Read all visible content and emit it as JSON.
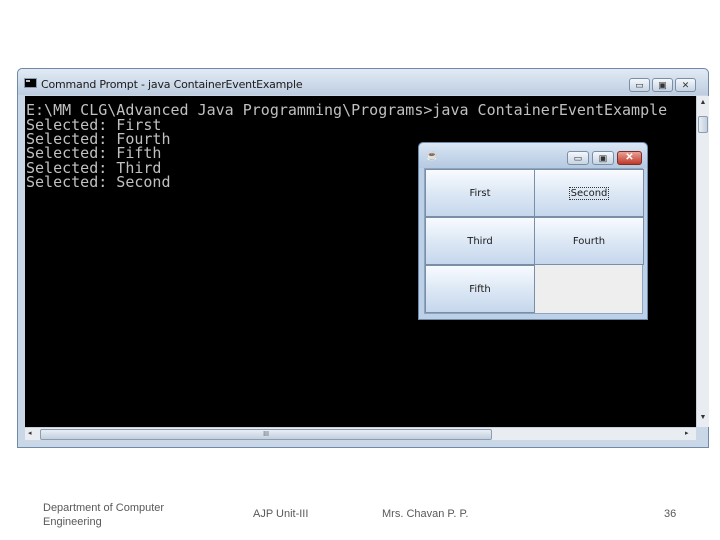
{
  "cmd_window": {
    "title": "Command Prompt - java  ContainerEventExample",
    "icon": "console-icon",
    "controls": {
      "minimize": "▭",
      "maximize": "▣",
      "close": "✕"
    }
  },
  "console": {
    "lines": [
      "E:\\MM CLG\\Advanced Java Programming\\Programs>java ContainerEventExample",
      "Selected: First",
      "Selected: Fourth",
      "Selected: Fifth",
      "Selected: Third",
      "Selected: Second"
    ],
    "text_color": "#c0c0c0",
    "background": "#000000"
  },
  "scrollbars": {
    "up": "▲",
    "down": "▼",
    "left": "◂",
    "right": "▸",
    "grip": "III"
  },
  "java_frame": {
    "icon": "java-cup-icon",
    "controls": {
      "minimize": "▭",
      "maximize": "▣",
      "close": "✕"
    },
    "buttons": [
      "First",
      "Second",
      "Third",
      "Fourth",
      "Fifth"
    ],
    "focused_button": "Second"
  },
  "footer": {
    "department": "Department of Computer Engineering",
    "unit": "AJP Unit-III",
    "author": "Mrs. Chavan P. P.",
    "page": "36"
  }
}
